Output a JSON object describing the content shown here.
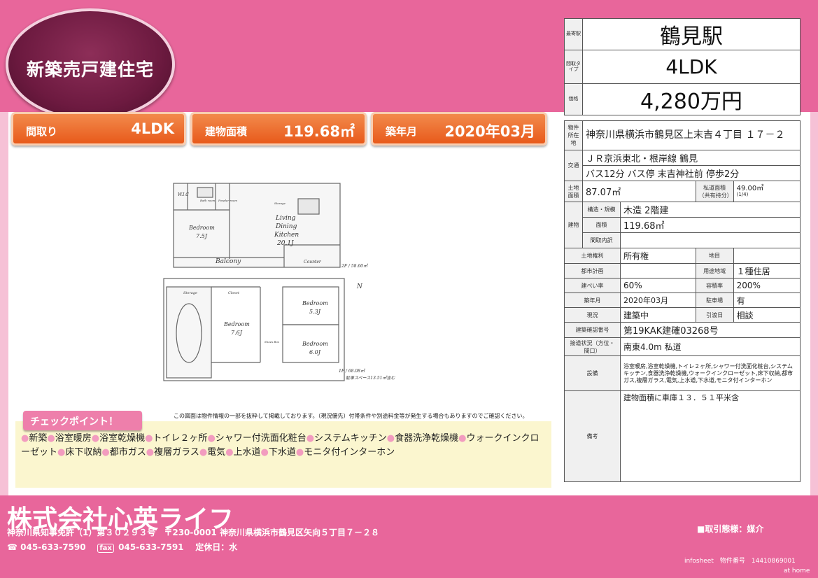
{
  "header": {
    "badge": "新築売戸建住宅",
    "pills": [
      {
        "label": "間取り",
        "value": "4LDK"
      },
      {
        "label": "建物面積",
        "value": "119.68㎡"
      },
      {
        "label": "築年月",
        "value": "2020年03月"
      }
    ]
  },
  "summary": {
    "station_key": "最寄駅",
    "station": "鶴見駅",
    "layout_key": "間取タイプ",
    "layout": "4LDK",
    "price_key": "価格",
    "price": "4,280万円"
  },
  "info": {
    "location_key": "物件所在地",
    "location": "神奈川県横浜市鶴見区上末吉４丁目 １７－２",
    "transport_key": "交通",
    "transport1": "ＪＲ京浜東北・根岸線 鶴見",
    "transport2": "バス12分 バス停 末吉神社前 停歩2分",
    "land_area_key": "土地面積",
    "land_area": "87.07㎡",
    "private_road_key": "私道面積（共有持分）",
    "private_road": "49.00㎡",
    "private_road_share": "(1/4)",
    "building_key": "建物",
    "structure_key": "構造・規模",
    "structure": "木造 2階建",
    "area_key": "面積",
    "area": "119.68㎡",
    "layout_detail_key": "間取内訳",
    "layout_detail": "",
    "land_right_key": "土地権利",
    "land_right": "所有権",
    "chimoku_key": "地目",
    "chimoku": "",
    "city_plan_key": "都市計画",
    "city_plan": "",
    "zoning_key": "用途地域",
    "zoning": "１種住居",
    "coverage_key": "建ぺい率",
    "coverage": "60%",
    "far_key": "容積率",
    "far": "200%",
    "built_key": "築年月",
    "built": "2020年03月",
    "parking_key": "駐車場",
    "parking": "有",
    "status_key": "現況",
    "status": "建築中",
    "handover_key": "引渡日",
    "handover": "相談",
    "permit_key": "建築確認番号",
    "permit": "第19KAK建確03268号",
    "road_key": "接道状況（方位・間口）",
    "road": "南東4.0m 私道",
    "equipment_key": "設備",
    "equipment": "浴室暖房,浴室乾燥機,トイレ２ヶ所,シャワー付洗面化粧台,システムキッチン,食器洗浄乾燥機,ウォークインクローゼット,床下収納,都市ガス,複層ガラス,電気,上水道,下水道,モニタ付インターホン",
    "remarks_key": "備考",
    "remarks": "建物面積に車庫１３．５１平米含"
  },
  "floorplan": {
    "wic": "W.I.C",
    "bath": "Bath room",
    "powder": "Powder room",
    "bedroom1": "Bedroom",
    "bedroom1_size": "7.5J",
    "ldk1": "Living",
    "ldk2": "Dining",
    "ldk3": "Kitchen",
    "ldk_size": "20.1J",
    "balcony": "Balcony",
    "counter": "Counter",
    "storage_small": "Storage",
    "floor2": "2F / 58.60㎡",
    "storage": "Storage",
    "closet": "Closet",
    "bedroom2": "Bedroom",
    "bedroom2_size": "7.6J",
    "bedroom3": "Bedroom",
    "bedroom3_size": "5.3J",
    "bedroom4": "Bedroom",
    "bedroom4_size": "6.0J",
    "shoes": "Shoes Box",
    "floor1": "1F / 68.08㎡",
    "parking_note": "駐車スペース13.51㎡含む",
    "north": "N"
  },
  "note": "この図面は物件情報の一部を抜粋して掲載しております。（現況優先）付帯条件や別途料金等が発生する場合もありますのでご確認ください。",
  "check": {
    "title": "チェックポイント！",
    "items": [
      "新築",
      "浴室暖房",
      "浴室乾燥機",
      "トイレ２ヶ所",
      "シャワー付洗面化粧台",
      "システムキッチン",
      "食器洗浄乾燥機",
      "ウォークインクローゼット",
      "床下収納",
      "都市ガス",
      "複層ガラス",
      "電気",
      "上水道",
      "下水道",
      "モニタ付インターホン"
    ]
  },
  "footer": {
    "company": "株式会社心英ライフ",
    "license": "神奈川県知事免許（1）第３０２９３号　〒230-0001 神奈川県横浜市鶴見区矢向５丁目７－２８",
    "tel_icon": "☎",
    "tel": "045-633-7590",
    "fax_icon": "fax",
    "fax": "045-633-7591",
    "holiday": "定休日：水",
    "deal": "■取引態様：媒介",
    "infosheet": "infosheet　物件番号　14410869001",
    "brand": "at home"
  },
  "colors": {
    "band": "#e8669b",
    "pill": "#e85a1b",
    "check_bg": "#fbf6cf"
  }
}
